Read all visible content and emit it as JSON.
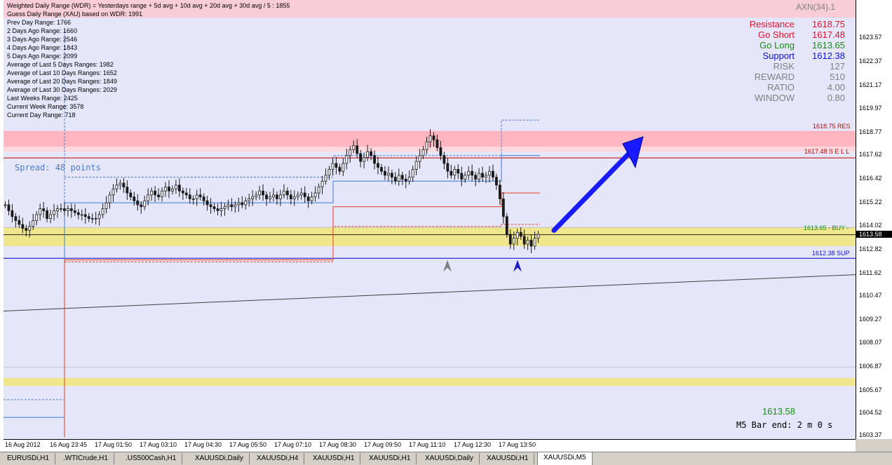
{
  "info_lines": [
    "Weighted Daily Range (WDR) = Yesterdays range + 5d avg + 10d avg + 20d avg + 30d avg / 5 : 1855",
    "Guess Daily Range (XAU) based on WDR: 1991",
    "Prev Day Range: 1766",
    "2 Days Ago Range: 1660",
    "3 Days Ago Range: 2546",
    "4 Days Ago Range: 1843",
    "5 Days Ago Range: 2099",
    "Average of Last 5 Days Ranges: 1982",
    "Average of Last 10 Days Ranges: 1652",
    "Average of Last 20 Days Ranges: 1849",
    "Average of Last 30 Days Ranges: 2029",
    "Last Weeks Range: 2425",
    "Current Week Range: 3578",
    "Current Day Range: 718"
  ],
  "spread_text": "Spread: 48 points",
  "indicator_name": "AXN(34).1",
  "panel": [
    {
      "label": "Resistance",
      "value": "1618.75",
      "color": "#e0102a"
    },
    {
      "label": "Go Short",
      "value": "1617.48",
      "color": "#e0102a"
    },
    {
      "label": "Go Long",
      "value": "1613.65",
      "color": "#1a8a1a"
    },
    {
      "label": "Support",
      "value": "1612.38",
      "color": "#1010d0"
    },
    {
      "label": "RISK",
      "value": "127",
      "color": "#808080"
    },
    {
      "label": "REWARD",
      "value": "510",
      "color": "#808080"
    },
    {
      "label": "RATIO",
      "value": "4.00",
      "color": "#808080"
    },
    {
      "label": "WINDOW",
      "value": "0.80",
      "color": "#808080"
    }
  ],
  "zone_labels": {
    "res": "1618.75 RES",
    "sell": "1617.48 S E L L",
    "buy": "1613.65 - BUY -",
    "sup": "1612.38 SUP"
  },
  "current_price": "1613.58",
  "bar_end": "M5 Bar end: 2 m 0 s",
  "price_axis": {
    "min": 1603.2,
    "max": 1625.5,
    "labels": [
      "1623.57",
      "1622.37",
      "1621.17",
      "1619.97",
      "1618.77",
      "1617.62",
      "1616.42",
      "1615.22",
      "1614.02",
      "1612.82",
      "1611.62",
      "1610.47",
      "1609.27",
      "1608.07",
      "1606.87",
      "1605.67",
      "1604.52",
      "1603.37"
    ],
    "current_label": "1613.58"
  },
  "time_axis": [
    "16 Aug 2012",
    "16 Aug 23:45",
    "17 Aug 01:50",
    "17 Aug 03:10",
    "17 Aug 04:30",
    "17 Aug 05:50",
    "17 Aug 07:10",
    "17 Aug 08:30",
    "17 Aug 09:50",
    "17 Aug 11:10",
    "17 Aug 12:30",
    "17 Aug 13:50"
  ],
  "tabs": [
    {
      "label": "EURUSDi,H1",
      "active": false
    },
    {
      "label": ".WTICrude,H1",
      "active": false
    },
    {
      "label": ".US500Cash,H1",
      "active": false
    },
    {
      "label": "XAUUSDi,Daily",
      "active": false
    },
    {
      "label": "XAUUSDi,H4",
      "active": false
    },
    {
      "label": "XAUUSDi,H1",
      "active": false
    },
    {
      "label": "XAUUSDi,H1",
      "active": false
    },
    {
      "label": "XAUUSDi,Daily",
      "active": false
    },
    {
      "label": "XAUUSDi,H1",
      "active": false
    },
    {
      "label": "XAUUSDi,M5",
      "active": true
    }
  ],
  "levels": {
    "resistance": 1618.75,
    "go_short": 1617.48,
    "go_long": 1613.65,
    "support": 1612.38,
    "current": 1613.58
  },
  "colors": {
    "chart_bg": "#e6e6fa",
    "res_zone": "#ffb6c1",
    "buy_zone": "#f0e68c",
    "support_line": "#0000c0",
    "sell_line": "#c00000",
    "arrow": "#1a1aff",
    "candle": "#1a1a1a"
  },
  "closes": [
    1615.1,
    1614.8,
    1614.5,
    1614.3,
    1614.1,
    1613.9,
    1613.8,
    1614.0,
    1614.3,
    1614.6,
    1614.9,
    1614.8,
    1614.4,
    1614.6,
    1614.8,
    1614.9,
    1614.9,
    1614.8,
    1614.9,
    1614.8,
    1614.7,
    1614.6,
    1614.6,
    1614.5,
    1614.4,
    1614.4,
    1614.4,
    1614.6,
    1614.9,
    1615.2,
    1615.6,
    1615.9,
    1616.1,
    1616.2,
    1616.0,
    1615.7,
    1615.5,
    1615.3,
    1615.1,
    1615.0,
    1615.3,
    1615.6,
    1615.8,
    1615.6,
    1615.5,
    1615.8,
    1616.0,
    1615.8,
    1615.9,
    1616.1,
    1615.8,
    1615.7,
    1615.6,
    1615.4,
    1615.4,
    1615.6,
    1615.5,
    1615.3,
    1615.1,
    1615.0,
    1614.9,
    1614.8,
    1614.9,
    1615.0,
    1615.1,
    1615.0,
    1615.1,
    1615.2,
    1615.1,
    1615.3,
    1615.4,
    1615.5,
    1615.6,
    1615.8,
    1615.6,
    1615.4,
    1615.5,
    1615.6,
    1615.4,
    1615.6,
    1615.8,
    1615.6,
    1615.4,
    1615.5,
    1615.6,
    1615.7,
    1615.5,
    1615.3,
    1615.5,
    1615.7,
    1616.0,
    1616.3,
    1616.6,
    1616.9,
    1617.2,
    1617.0,
    1616.8,
    1617.2,
    1617.6,
    1617.9,
    1618.1,
    1617.7,
    1617.3,
    1617.5,
    1617.8,
    1617.6,
    1617.2,
    1617.0,
    1616.8,
    1616.6,
    1616.7,
    1616.5,
    1616.3,
    1616.6,
    1616.4,
    1616.3,
    1616.5,
    1616.9,
    1617.3,
    1617.6,
    1617.9,
    1618.3,
    1618.6,
    1618.4,
    1618.0,
    1617.6,
    1617.2,
    1616.8,
    1616.6,
    1616.9,
    1616.7,
    1616.4,
    1616.6,
    1616.8,
    1616.6,
    1616.4,
    1616.7,
    1616.5,
    1616.6,
    1616.8,
    1616.5,
    1616.1,
    1615.4,
    1614.5,
    1613.6,
    1613.1,
    1613.4,
    1613.7,
    1613.5,
    1613.1,
    1613.3,
    1613.0,
    1613.4,
    1613.6
  ]
}
